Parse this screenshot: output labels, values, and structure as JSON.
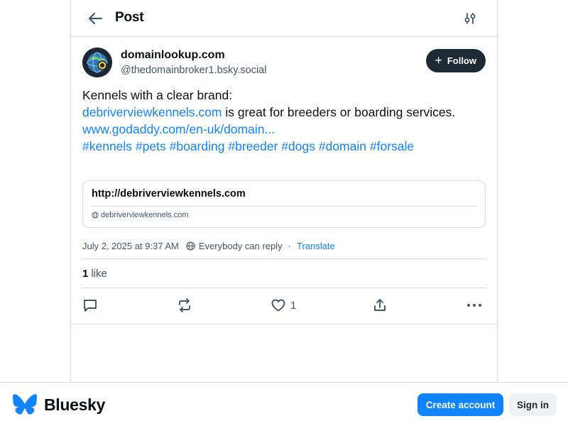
{
  "header": {
    "title": "Post",
    "back_icon": "arrow-left-icon",
    "settings_icon": "sliders-icon"
  },
  "author": {
    "display_name": "domainlookup.com",
    "handle": "@thedomainbroker1.bsky.social",
    "follow_label": "Follow"
  },
  "post": {
    "line1": "Kennels with a clear brand:",
    "link1": "debriverviewkennels.com",
    "line2_rest": " is great for breeders or boarding services.",
    "link2": "www.godaddy.com/en-uk/domain...",
    "hashtags": [
      "#kennels",
      "#pets",
      "#boarding",
      "#breeder",
      "#dogs",
      "#domain",
      "#forsale"
    ]
  },
  "card": {
    "url": "http://debriverviewkennels.com",
    "domain": "debriverviewkennels.com"
  },
  "meta": {
    "date": "July 2, 2025 at 9:37 AM",
    "reply_setting": "Everybody can reply",
    "separator": "·",
    "translate": "Translate"
  },
  "likes": {
    "count": "1",
    "label": "like"
  },
  "actions": {
    "like_count": "1"
  },
  "footer": {
    "brand": "Bluesky",
    "create_account": "Create account",
    "sign_in": "Sign in"
  },
  "colors": {
    "accent": "#1083fe",
    "text": "#0b0f14",
    "muted": "#42576c",
    "border": "#d4dbe2",
    "follow_bg": "#1e2936"
  }
}
